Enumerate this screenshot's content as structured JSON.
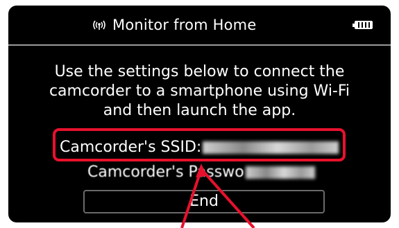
{
  "header": {
    "title": "Monitor from Home",
    "icon": "wifi-signal-icon",
    "battery_icon": "battery-icon"
  },
  "message": {
    "lines": [
      "Use the settings below to connect the",
      "camcorder to a smartphone using Wi-Fi",
      "and then launch the app."
    ]
  },
  "ssid": {
    "label": "Camcorder's SSID:"
  },
  "password": {
    "label": "Camcorder's Passwo"
  },
  "end_button": {
    "label": "End"
  },
  "colors": {
    "highlight": "#e8112d",
    "screen_bg": "#000000",
    "text": "#ffffff"
  }
}
